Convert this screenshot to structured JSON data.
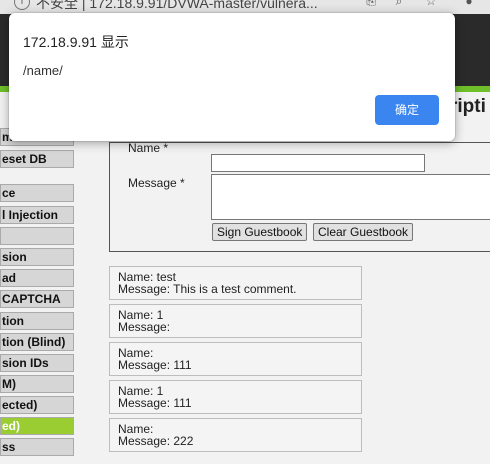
{
  "browser": {
    "url_text": "不安全 | 172.18.9.91/DVWA-master/vulnera..."
  },
  "page": {
    "title": "ripti"
  },
  "sidebar": {
    "items": [
      {
        "label": "m"
      },
      {
        "label": "eset DB"
      },
      {
        "label": "ce"
      },
      {
        "label": "l Injection"
      },
      {
        "label": ""
      },
      {
        "label": "sion"
      },
      {
        "label": "ad"
      },
      {
        "label": "CAPTCHA"
      },
      {
        "label": "tion"
      },
      {
        "label": "tion (Blind)"
      },
      {
        "label": "sion IDs"
      },
      {
        "label": "M)"
      },
      {
        "label": "ected)"
      },
      {
        "label": "ed)"
      },
      {
        "label": "ss"
      }
    ]
  },
  "form": {
    "name_label": "Name *",
    "message_label": "Message *",
    "sign_button": "Sign Guestbook",
    "clear_button": "Clear Guestbook"
  },
  "comments": [
    {
      "name": "Name: test",
      "message": "Message: This is a test comment."
    },
    {
      "name": "Name: 1",
      "message": "Message:"
    },
    {
      "name": "Name:",
      "message": "Message: 111"
    },
    {
      "name": "Name: 1",
      "message": "Message: 111"
    },
    {
      "name": "Name:",
      "message": "Message: 222"
    }
  ],
  "dialog": {
    "title": "172.18.9.91 显示",
    "message": "/name/",
    "ok_label": "确定"
  },
  "colors": {
    "accent_green": "#9acd32",
    "dialog_button": "#3a85f0"
  }
}
